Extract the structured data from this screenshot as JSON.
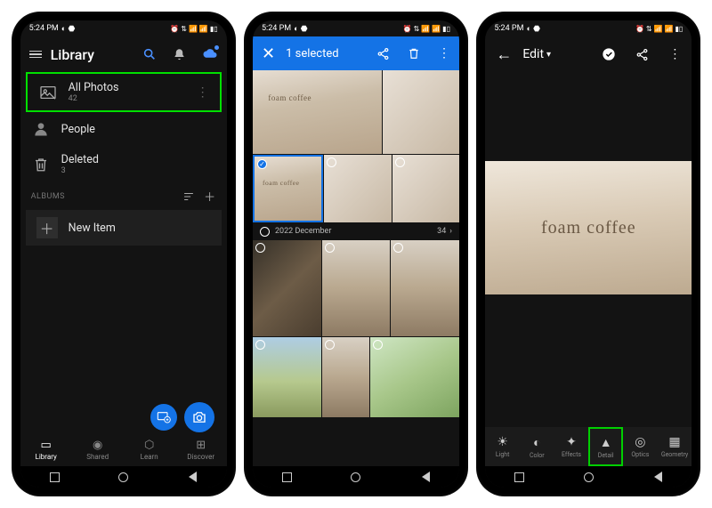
{
  "status": {
    "time": "5:24 PM",
    "icons": "⏰ ⇅ 📶 📶 ▮▯"
  },
  "phone1": {
    "header": {
      "title": "Library"
    },
    "items": {
      "allphotos": {
        "label": "All Photos",
        "count": "42"
      },
      "people": {
        "label": "People"
      },
      "deleted": {
        "label": "Deleted",
        "count": "3"
      }
    },
    "albums_header": "ALBUMS",
    "newitem": "New Item",
    "tabs": {
      "library": "Library",
      "shared": "Shared",
      "learn": "Learn",
      "discover": "Discover"
    }
  },
  "phone2": {
    "header": {
      "title": "1 selected"
    },
    "date": {
      "label": "2022 December",
      "count": "34"
    },
    "sign": "foam coffee"
  },
  "phone3": {
    "header": {
      "title": "Edit"
    },
    "sign": "foam  coffee",
    "tabs": {
      "light": "Light",
      "color": "Color",
      "effects": "Effects",
      "detail": "Detail",
      "optics": "Optics",
      "geometry": "Geometry"
    }
  }
}
